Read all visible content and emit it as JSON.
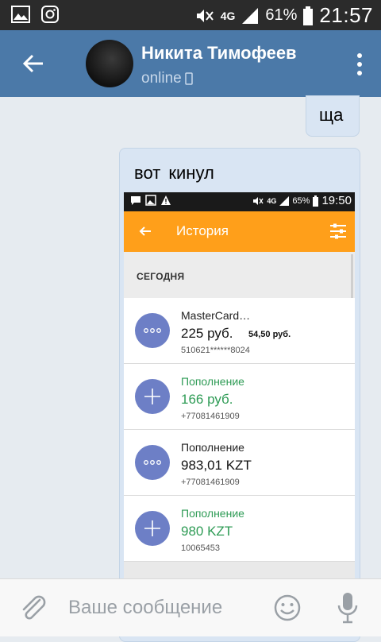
{
  "status_bar": {
    "battery": "61%",
    "time": "21:57",
    "network": "4G"
  },
  "header": {
    "contact_name": "Никита Тимофеев",
    "status": "online"
  },
  "messages": [
    {
      "text": "ща"
    },
    {
      "text": "вот кинул"
    }
  ],
  "attachment": {
    "status_bar": {
      "battery": "65%",
      "time": "19:50",
      "network": "4G"
    },
    "title": "История",
    "section": "СЕГОДНЯ",
    "transactions": [
      {
        "title": "MasterCard…",
        "amount": "225 руб.",
        "fee": "54,50 руб.",
        "details": "510621******8024",
        "type": "payment"
      },
      {
        "title": "Пополнение",
        "amount": "166 руб.",
        "details": "+77081461909",
        "type": "topup"
      },
      {
        "title": "Пополнение",
        "amount": "983,01 KZT",
        "details": "+77081461909",
        "type": "payment"
      },
      {
        "title": "Пополнение",
        "amount": "980 KZT",
        "details": "10065453",
        "type": "topup"
      }
    ]
  },
  "composer": {
    "placeholder": "Ваше сообщение"
  },
  "colors": {
    "header": "#4b79a8",
    "bubble": "#d9e5f3",
    "accent_orange": "#ff9f1a",
    "icon_blue": "#6d7fc6",
    "green": "#2e9b55"
  }
}
